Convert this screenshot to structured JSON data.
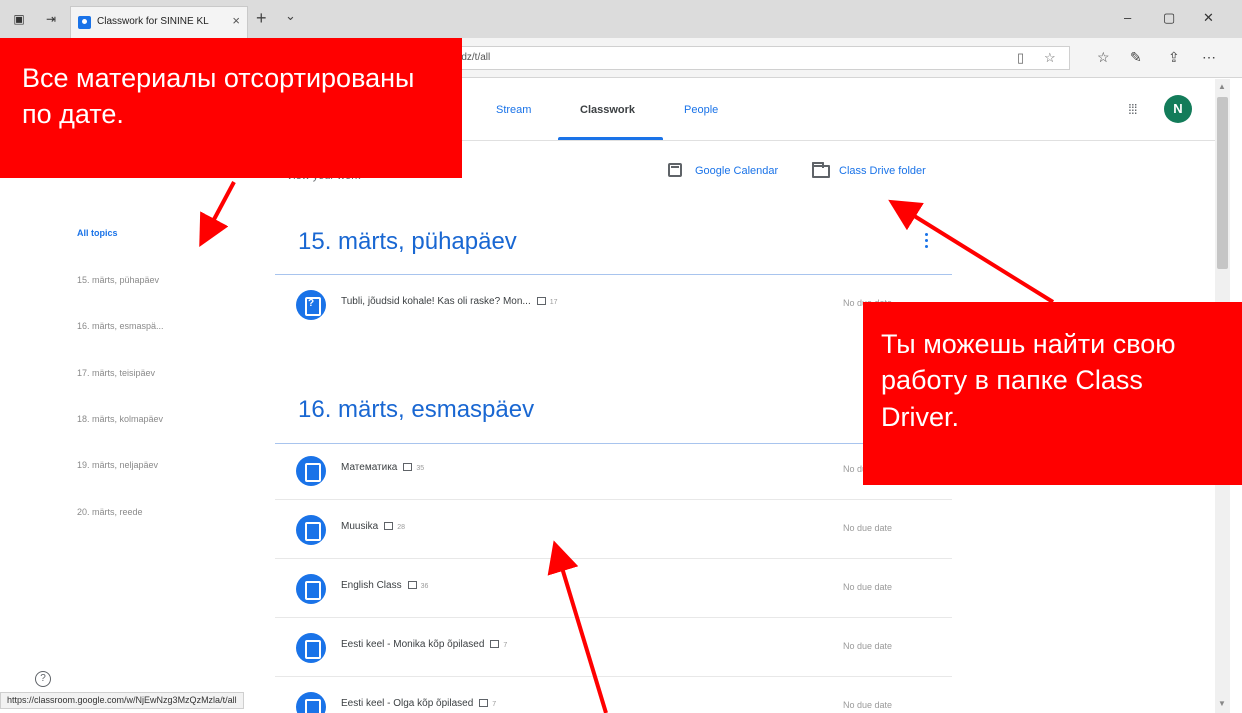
{
  "browser": {
    "tab_title": "Classwork for SININE KL",
    "tab_close": "×",
    "new_tab": "+",
    "tab_menu": "⌄",
    "url": "...dz/t/all",
    "status_url": "https://classroom.google.com/w/NjEwNzg3MzQzMzla/t/all",
    "window_controls": [
      "–",
      "▢",
      "✕"
    ],
    "icons": [
      "reading-view-icon",
      "favorite-star-icon",
      "favorites-icon",
      "pen-icon",
      "share-icon",
      "more-icon"
    ]
  },
  "classroom": {
    "nav_tabs": [
      {
        "label": "Stream",
        "active": false
      },
      {
        "label": "Classwork",
        "active": true
      },
      {
        "label": "People",
        "active": false
      }
    ],
    "avatar_initial": "N",
    "view_work": "View your work",
    "calendar_link": "Google Calendar",
    "drive_link": "Class Drive folder",
    "topics": [
      {
        "label": "All topics",
        "active": true
      },
      {
        "label": "15. märts, pühapäev",
        "active": false
      },
      {
        "label": "16. märts, esmaspä...",
        "active": false
      },
      {
        "label": "17. märts, teisipäev",
        "active": false
      },
      {
        "label": "18. märts, kolmapäev",
        "active": false
      },
      {
        "label": "19. märts, neljapäev",
        "active": false
      },
      {
        "label": "20. märts, reede",
        "active": false
      }
    ],
    "sections": [
      {
        "title": "15. märts, pühapäev",
        "items": [
          {
            "title": "Tubli, jõudsid kohale! Kas oli raske? Mon...",
            "count": "17",
            "due": "No due date",
            "type": "question"
          }
        ]
      },
      {
        "title": "16. märts, esmaspäev",
        "items": [
          {
            "title": "Математика",
            "count": "35",
            "due": "No due date",
            "type": "assignment"
          },
          {
            "title": "Muusika",
            "count": "28",
            "due": "No due date",
            "type": "assignment"
          },
          {
            "title": "English Class",
            "count": "36",
            "due": "No due date",
            "type": "assignment"
          },
          {
            "title": "Eesti keel - Monika kõp õpilased",
            "count": "7",
            "due": "No due date",
            "type": "assignment"
          },
          {
            "title": "Eesti keel - Olga kõp õpilased",
            "count": "7",
            "due": "No due date",
            "type": "assignment"
          }
        ]
      }
    ],
    "help": "?"
  },
  "annotations": {
    "callout_sorted": "Все материалы отсортированы по дате.",
    "callout_drive": "Ты можешь найти свою работу в папке Class Driver."
  },
  "colors": {
    "accent": "#1a73e8",
    "callout_red": "#ff0000",
    "avatar_green": "#137c5a"
  }
}
